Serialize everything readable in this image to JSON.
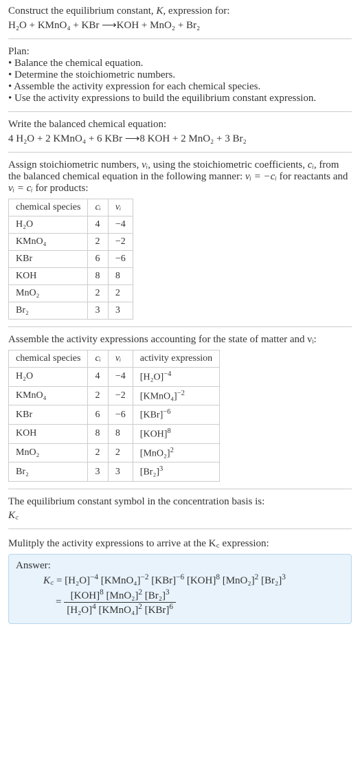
{
  "intro": {
    "line1_pre": "Construct the equilibrium constant, ",
    "K": "K",
    "line1_post": ", expression for:",
    "eq_lhs": "H₂O + KMnO₄ + KBr",
    "eq_rhs": "KOH + MnO₂ + Br₂"
  },
  "plan": {
    "heading": "Plan:",
    "b1": "• Balance the chemical equation.",
    "b2": "• Determine the stoichiometric numbers.",
    "b3": "• Assemble the activity expression for each chemical species.",
    "b4": "• Use the activity expressions to build the equilibrium constant expression."
  },
  "balanced": {
    "line": "Write the balanced chemical equation:",
    "eq_lhs": "4 H₂O + 2 KMnO₄ + 6 KBr",
    "eq_rhs": "8 KOH + 2 MnO₂ + 3 Br₂"
  },
  "stoich_intro": {
    "part1": "Assign stoichiometric numbers, ",
    "nu_i": "νᵢ",
    "part2": ", using the stoichiometric coefficients, ",
    "c_i": "cᵢ",
    "part3": ", from the balanced chemical equation in the following manner: ",
    "rel1": "νᵢ = −cᵢ",
    "part4": " for reactants and ",
    "rel2": "νᵢ = cᵢ",
    "part5": " for products:"
  },
  "table1": {
    "h1": "chemical species",
    "h2": "cᵢ",
    "h3": "νᵢ",
    "rows": [
      {
        "sp": "H₂O",
        "c": "4",
        "nu": "−4"
      },
      {
        "sp": "KMnO₄",
        "c": "2",
        "nu": "−2"
      },
      {
        "sp": "KBr",
        "c": "6",
        "nu": "−6"
      },
      {
        "sp": "KOH",
        "c": "8",
        "nu": "8"
      },
      {
        "sp": "MnO₂",
        "c": "2",
        "nu": "2"
      },
      {
        "sp": "Br₂",
        "c": "3",
        "nu": "3"
      }
    ]
  },
  "activity_intro": "Assemble the activity expressions accounting for the state of matter and νᵢ:",
  "table2": {
    "h1": "chemical species",
    "h2": "cᵢ",
    "h3": "νᵢ",
    "h4": "activity expression",
    "rows": [
      {
        "sp": "H₂O",
        "c": "4",
        "nu": "−4",
        "act_base": "[H₂O]",
        "act_exp": "−4"
      },
      {
        "sp": "KMnO₄",
        "c": "2",
        "nu": "−2",
        "act_base": "[KMnO₄]",
        "act_exp": "−2"
      },
      {
        "sp": "KBr",
        "c": "6",
        "nu": "−6",
        "act_base": "[KBr]",
        "act_exp": "−6"
      },
      {
        "sp": "KOH",
        "c": "8",
        "nu": "8",
        "act_base": "[KOH]",
        "act_exp": "8"
      },
      {
        "sp": "MnO₂",
        "c": "2",
        "nu": "2",
        "act_base": "[MnO₂]",
        "act_exp": "2"
      },
      {
        "sp": "Br₂",
        "c": "3",
        "nu": "3",
        "act_base": "[Br₂]",
        "act_exp": "3"
      }
    ]
  },
  "kc_symbol": {
    "line": "The equilibrium constant symbol in the concentration basis is:",
    "sym": "K꜀"
  },
  "multiply_line": "Mulitply the activity expressions to arrive at the K꜀ expression:",
  "answer": {
    "label": "Answer:",
    "kc": "K꜀",
    "eq_sign": " = ",
    "prod_terms": [
      {
        "base": "[H₂O]",
        "exp": "−4"
      },
      {
        "base": "[KMnO₄]",
        "exp": "−2"
      },
      {
        "base": "[KBr]",
        "exp": "−6"
      },
      {
        "base": "[KOH]",
        "exp": "8"
      },
      {
        "base": "[MnO₂]",
        "exp": "2"
      },
      {
        "base": "[Br₂]",
        "exp": "3"
      }
    ],
    "frac_num": [
      {
        "base": "[KOH]",
        "exp": "8"
      },
      {
        "base": "[MnO₂]",
        "exp": "2"
      },
      {
        "base": "[Br₂]",
        "exp": "3"
      }
    ],
    "frac_den": [
      {
        "base": "[H₂O]",
        "exp": "4"
      },
      {
        "base": "[KMnO₄]",
        "exp": "2"
      },
      {
        "base": "[KBr]",
        "exp": "6"
      }
    ]
  },
  "chart_data": {
    "type": "table",
    "tables": [
      {
        "title": "stoichiometric numbers",
        "columns": [
          "chemical species",
          "c_i",
          "nu_i"
        ],
        "rows": [
          [
            "H2O",
            4,
            -4
          ],
          [
            "KMnO4",
            2,
            -2
          ],
          [
            "KBr",
            6,
            -6
          ],
          [
            "KOH",
            8,
            8
          ],
          [
            "MnO2",
            2,
            2
          ],
          [
            "Br2",
            3,
            3
          ]
        ]
      },
      {
        "title": "activity expressions",
        "columns": [
          "chemical species",
          "c_i",
          "nu_i",
          "activity expression"
        ],
        "rows": [
          [
            "H2O",
            4,
            -4,
            "[H2O]^-4"
          ],
          [
            "KMnO4",
            2,
            -2,
            "[KMnO4]^-2"
          ],
          [
            "KBr",
            6,
            -6,
            "[KBr]^-6"
          ],
          [
            "KOH",
            8,
            8,
            "[KOH]^8"
          ],
          [
            "MnO2",
            2,
            2,
            "[MnO2]^2"
          ],
          [
            "Br2",
            3,
            3,
            "[Br2]^3"
          ]
        ]
      }
    ]
  }
}
